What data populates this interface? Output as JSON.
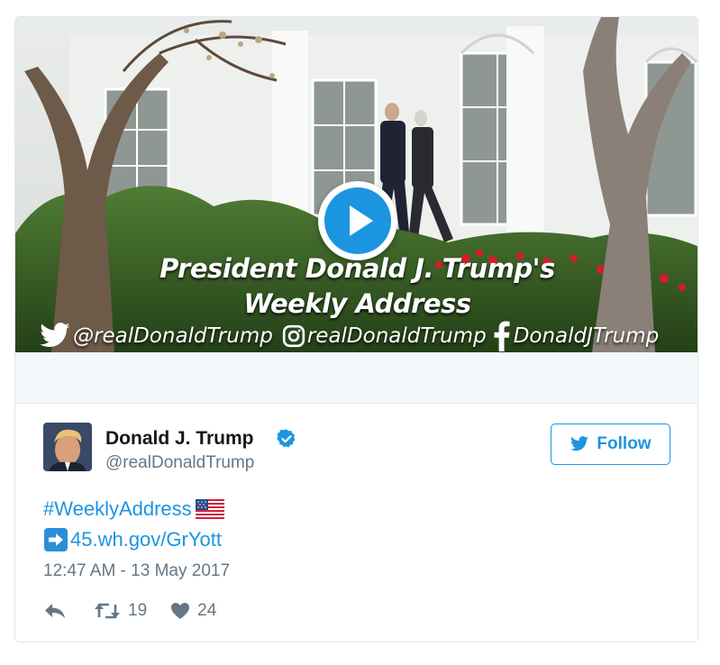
{
  "media": {
    "title_line1": "President Donald J. Trump's",
    "title_line2": "Weekly Address",
    "twitter_handle": "@realDonaldTrump",
    "instagram_handle": "realDonaldTrump",
    "facebook_handle": "DonaldJTrump"
  },
  "user": {
    "name": "Donald J. Trump",
    "handle": "@realDonaldTrump",
    "verified": true
  },
  "follow_label": "Follow",
  "tweet": {
    "hashtag": "#WeeklyAddress",
    "link": "45.wh.gov/GrYott",
    "timestamp": "12:47 AM - 13 May 2017"
  },
  "stats": {
    "retweets": "19",
    "likes": "24"
  },
  "icons": {
    "reply": "reply-icon",
    "retweet": "retweet-icon",
    "like": "heart-icon",
    "verified": "verified-badge-icon",
    "play": "play-icon",
    "flag": "us-flag-icon",
    "arrow": "right-arrow-icon"
  },
  "colors": {
    "accent": "#1b95e0",
    "muted": "#657786",
    "text": "#14171a",
    "border": "#e1e8ed"
  }
}
